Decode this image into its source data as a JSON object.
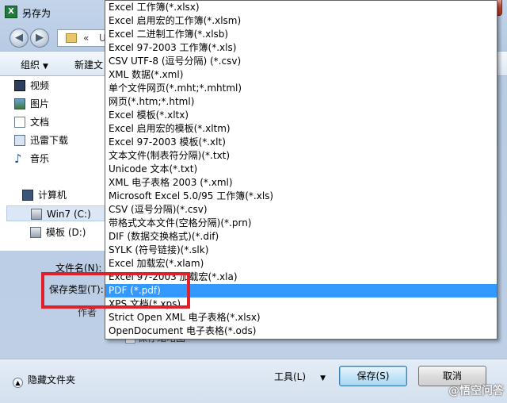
{
  "window": {
    "title": "另存为",
    "app_icon_letter": "X",
    "close_glyph": "✕"
  },
  "navigation": {
    "back_glyph": "◀",
    "forward_glyph": "▶",
    "address_prefix": "«",
    "address_text": "Us"
  },
  "toolbar": {
    "organize": "组织",
    "organize_arrow": "▼",
    "new_folder": "新建文"
  },
  "nav_pane": {
    "items": [
      {
        "label": "视频",
        "icon": "video-icon"
      },
      {
        "label": "图片",
        "icon": "picture-icon"
      },
      {
        "label": "文档",
        "icon": "document-icon"
      },
      {
        "label": "迅雷下载",
        "icon": "download-folder-icon"
      },
      {
        "label": "音乐",
        "icon": "music-icon"
      },
      {
        "label": "计算机",
        "icon": "computer-icon"
      },
      {
        "label": "Win7 (C:)",
        "icon": "drive-icon"
      },
      {
        "label": "模板 (D:)",
        "icon": "drive-icon"
      }
    ]
  },
  "form": {
    "filename_label": "文件名(N):",
    "savetype_label": "保存类型(T):",
    "authors_label": "作者",
    "thumbnail_label": "保存缩略图"
  },
  "dropdown": {
    "selected_index": 21,
    "options": [
      "Excel 工作簿(*.xlsx)",
      "Excel 启用宏的工作簿(*.xlsm)",
      "Excel 二进制工作簿(*.xlsb)",
      "Excel 97-2003 工作簿(*.xls)",
      "CSV UTF-8 (逗号分隔) (*.csv)",
      "XML 数据(*.xml)",
      "单个文件网页(*.mht;*.mhtml)",
      "网页(*.htm;*.html)",
      "Excel 模板(*.xltx)",
      "Excel 启用宏的模板(*.xltm)",
      "Excel 97-2003 模板(*.xlt)",
      "文本文件(制表符分隔)(*.txt)",
      "Unicode 文本(*.txt)",
      "XML 电子表格 2003 (*.xml)",
      "Microsoft Excel 5.0/95 工作簿(*.xls)",
      "CSV (逗号分隔)(*.csv)",
      "带格式文本文件(空格分隔)(*.prn)",
      "DIF (数据交换格式)(*.dif)",
      "SYLK (符号链接)(*.slk)",
      "Excel 加载宏(*.xlam)",
      "Excel 97-2003 加载宏(*.xla)",
      "PDF (*.pdf)",
      "XPS 文档(*.xps)",
      "Strict Open XML 电子表格(*.xlsx)",
      "OpenDocument 电子表格(*.ods)"
    ]
  },
  "bottom": {
    "hide_folders": "隐藏文件夹",
    "tools": "工具(L)",
    "tools_arrow": "▼",
    "save": "保存(S)",
    "cancel": "取消",
    "watermark": "@悟空问答"
  },
  "colors": {
    "selection": "#3399ff",
    "highlight_box": "#e0202a"
  }
}
